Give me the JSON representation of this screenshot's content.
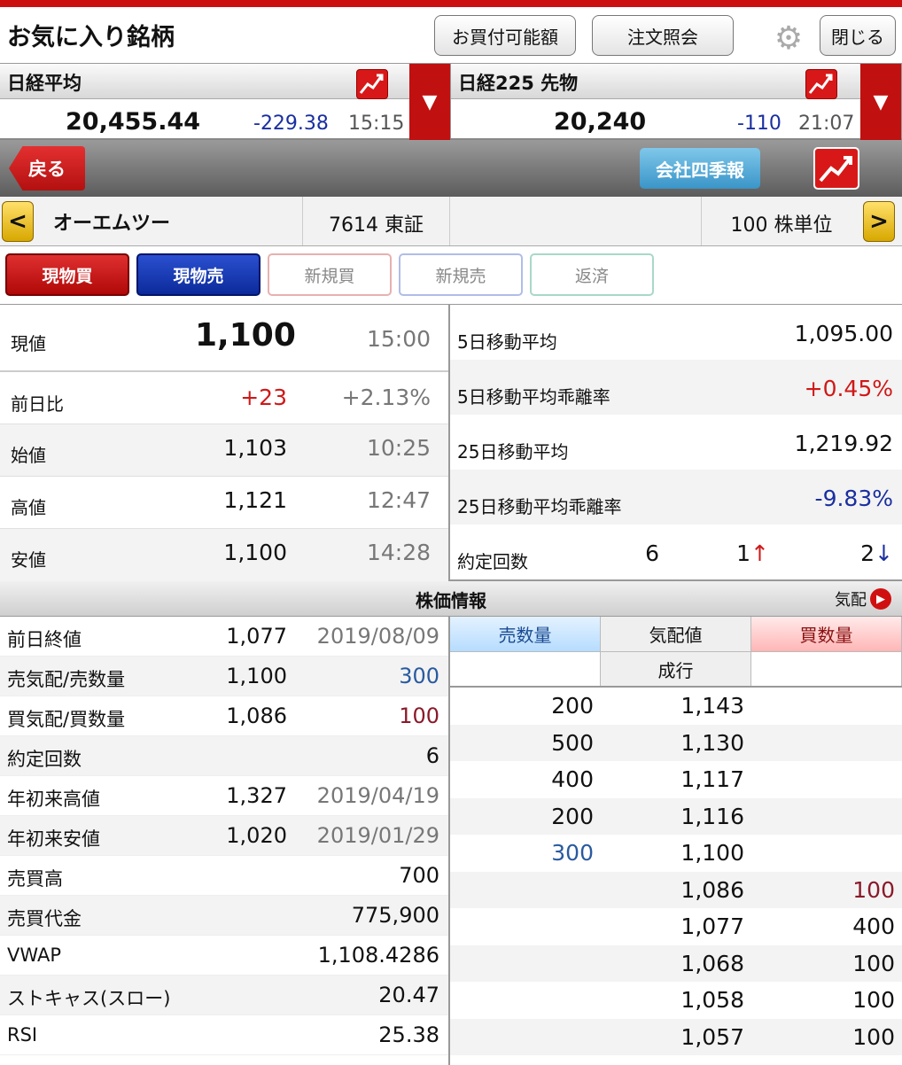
{
  "header": {
    "title": "お気に入り銘柄",
    "buying_power_btn": "お買付可能額",
    "order_inquiry_btn": "注文照会",
    "close_btn": "閉じる"
  },
  "indices": [
    {
      "name": "日経平均",
      "value": "20,455.44",
      "change": "-229.38",
      "time": "15:15"
    },
    {
      "name": "日経225 先物",
      "value": "20,240",
      "change": "-110",
      "time": "21:07"
    }
  ],
  "nav": {
    "back": "戻る",
    "quarterly": "会社四季報"
  },
  "stock": {
    "prev_arrow": "<",
    "next_arrow": ">",
    "name": "オーエムツー",
    "code_market": "7614 東証",
    "unit": "100 株単位"
  },
  "trade_buttons": [
    "現物買",
    "現物売",
    "新規買",
    "新規売",
    "返済"
  ],
  "quote": {
    "current": {
      "label": "現値",
      "value": "1,100",
      "time": "15:00"
    },
    "change": {
      "label": "前日比",
      "value": "+23",
      "pct": "+2.13%"
    },
    "open": {
      "label": "始値",
      "value": "1,103",
      "time": "10:25"
    },
    "high": {
      "label": "高値",
      "value": "1,121",
      "time": "12:47"
    },
    "low": {
      "label": "安値",
      "value": "1,100",
      "time": "14:28"
    }
  },
  "indicators": {
    "ma5": {
      "label": "5日移動平均",
      "value": "1,095.00"
    },
    "ma5_dev": {
      "label": "5日移動平均乖離率",
      "value": "+0.45%"
    },
    "ma25": {
      "label": "25日移動平均",
      "value": "1,219.92"
    },
    "ma25_dev": {
      "label": "25日移動平均乖離率",
      "value": "-9.83%"
    },
    "trades": {
      "label": "約定回数",
      "count": "6",
      "up": "1",
      "up_arrow": "↑",
      "down": "2",
      "down_arrow": "↓"
    }
  },
  "section": {
    "title": "株価情報",
    "kehai": "気配"
  },
  "info_rows": [
    {
      "label": "前日終値",
      "value": "1,077",
      "extra": "2019/08/09"
    },
    {
      "label": "売気配/売数量",
      "value": "1,100",
      "extra": "300"
    },
    {
      "label": "買気配/買数量",
      "value": "1,086",
      "extra": "100"
    },
    {
      "label": "約定回数",
      "value": "",
      "extra": "6"
    },
    {
      "label": "年初来高値",
      "value": "1,327",
      "extra": "2019/04/19"
    },
    {
      "label": "年初来安値",
      "value": "1,020",
      "extra": "2019/01/29"
    },
    {
      "label": "売買高",
      "value": "",
      "extra": "700"
    },
    {
      "label": "売買代金",
      "value": "",
      "extra": "775,900"
    },
    {
      "label": "VWAP",
      "value": "",
      "extra": "1,108.4286"
    },
    {
      "label": "ストキャス(スロー)",
      "value": "",
      "extra": "20.47"
    },
    {
      "label": "RSI",
      "value": "",
      "extra": "25.38"
    }
  ],
  "book": {
    "headers": {
      "sell": "売数量",
      "price": "気配値",
      "buy": "買数量"
    },
    "market": "成行",
    "rows": [
      {
        "sell": "200",
        "price": "1,143",
        "buy": ""
      },
      {
        "sell": "500",
        "price": "1,130",
        "buy": ""
      },
      {
        "sell": "400",
        "price": "1,117",
        "buy": ""
      },
      {
        "sell": "200",
        "price": "1,116",
        "buy": ""
      },
      {
        "sell": "300",
        "price": "1,100",
        "buy": ""
      },
      {
        "sell": "",
        "price": "1,086",
        "buy": "100"
      },
      {
        "sell": "",
        "price": "1,077",
        "buy": "400"
      },
      {
        "sell": "",
        "price": "1,068",
        "buy": "100"
      },
      {
        "sell": "",
        "price": "1,058",
        "buy": "100"
      },
      {
        "sell": "",
        "price": "1,057",
        "buy": "100"
      }
    ]
  },
  "colors": {
    "accent_red": "#cc1010",
    "up": "#d01818",
    "down": "#1a2fa0"
  }
}
